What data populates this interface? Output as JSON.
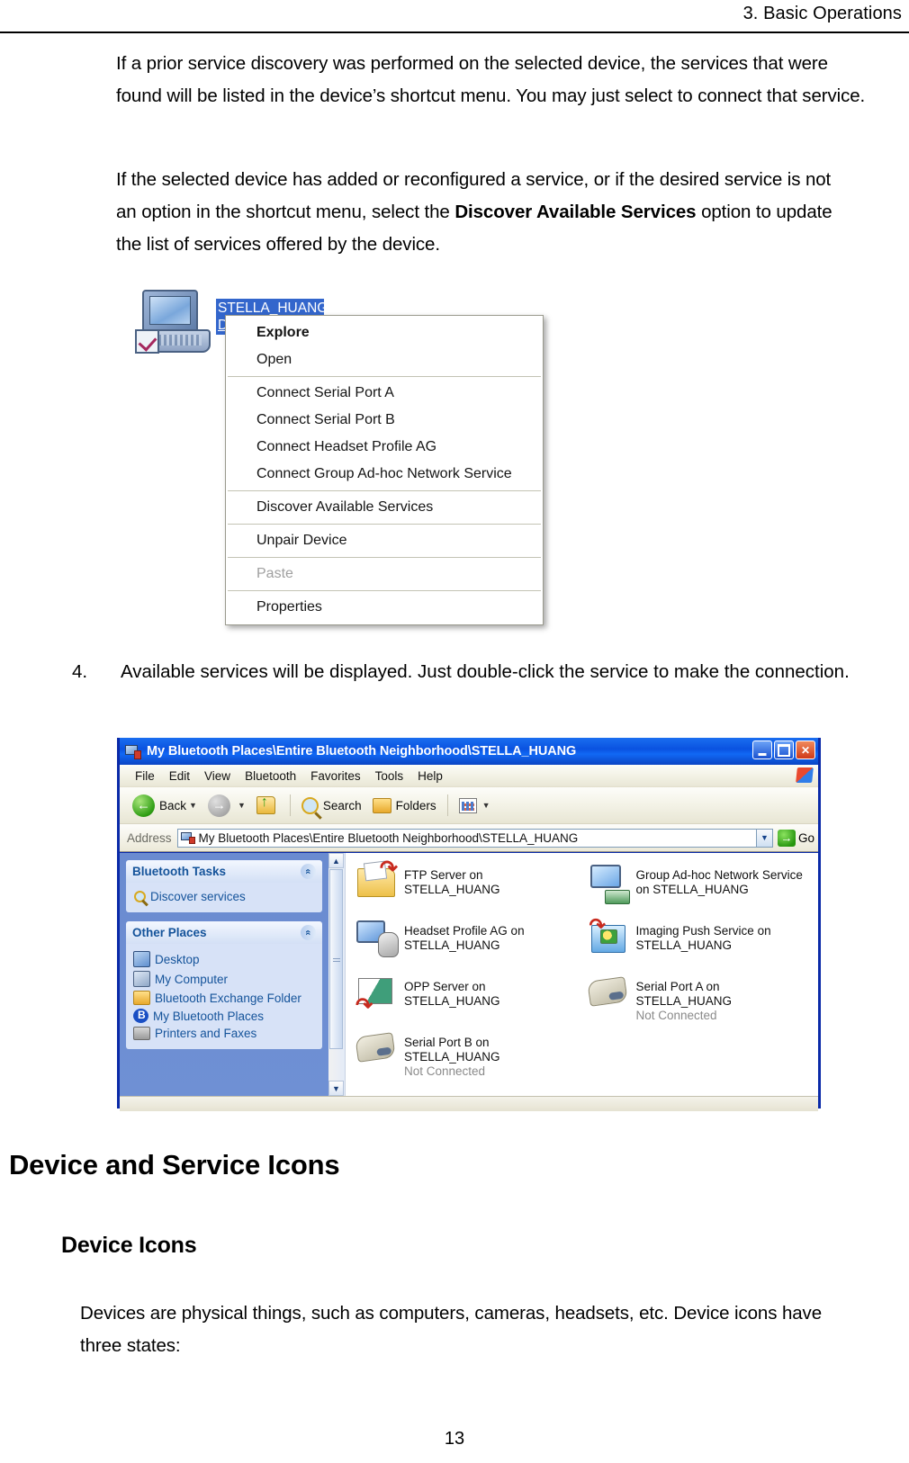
{
  "header": {
    "chapter": "3. Basic Operations"
  },
  "paragraphs": {
    "p1": "If a prior service discovery was performed on the selected device, the services that were found will be listed in the device’s shortcut menu. You may just select to connect that service.",
    "p2_a": "If the selected device has added or reconfigured a service, or if the desired service is not an option in the shortcut menu, select the ",
    "p2_bold": "Discover Available Services",
    "p2_b": " option to update the list of services offered by the device."
  },
  "step": {
    "number": "4.",
    "text": "Available services will be displayed. Just double-click the service to make the connection."
  },
  "context_menu_figure": {
    "device_label_line1": "STELLA_HUANG",
    "device_label_line2": "De",
    "items": [
      {
        "label": "Explore",
        "style": "bold"
      },
      {
        "label": "Open",
        "style": "normal"
      },
      {
        "label": "separator",
        "style": "separator"
      },
      {
        "label": "Connect Serial Port A",
        "style": "normal"
      },
      {
        "label": "Connect Serial Port B",
        "style": "normal"
      },
      {
        "label": "Connect Headset Profile AG",
        "style": "normal"
      },
      {
        "label": "Connect Group Ad-hoc Network Service",
        "style": "normal"
      },
      {
        "label": "separator",
        "style": "separator"
      },
      {
        "label": "Discover Available Services",
        "style": "normal"
      },
      {
        "label": "separator",
        "style": "separator"
      },
      {
        "label": "Unpair Device",
        "style": "normal"
      },
      {
        "label": "separator",
        "style": "separator"
      },
      {
        "label": "Paste",
        "style": "disabled"
      },
      {
        "label": "separator",
        "style": "separator"
      },
      {
        "label": "Properties",
        "style": "normal"
      }
    ]
  },
  "explorer_window": {
    "title": "My Bluetooth Places\\Entire Bluetooth Neighborhood\\STELLA_HUANG",
    "caption_buttons": {
      "minimize": "_",
      "maximize": "□",
      "close": "×"
    },
    "menus": [
      "File",
      "Edit",
      "View",
      "Bluetooth",
      "Favorites",
      "Tools",
      "Help"
    ],
    "toolbar": {
      "back": "Back",
      "forward": "",
      "up": "",
      "search": "Search",
      "folders": "Folders",
      "views": ""
    },
    "address": {
      "label": "Address",
      "value": "My Bluetooth Places\\Entire Bluetooth Neighborhood\\STELLA_HUANG",
      "go": "Go"
    },
    "sidebar": {
      "panels": [
        {
          "title": "Bluetooth Tasks",
          "links": [
            {
              "label": "Discover services",
              "icon": "magnify-icon"
            }
          ]
        },
        {
          "title": "Other Places",
          "links": [
            {
              "label": "Desktop",
              "icon": "desktop-icon"
            },
            {
              "label": "My Computer",
              "icon": "my-computer-icon"
            },
            {
              "label": "Bluetooth Exchange Folder",
              "icon": "folder-icon"
            },
            {
              "label": "My Bluetooth Places",
              "icon": "bluetooth-icon"
            },
            {
              "label": "Printers and Faxes",
              "icon": "printer-icon"
            }
          ]
        }
      ]
    },
    "files": [
      {
        "name": "FTP Server on STELLA_HUANG",
        "sub": "",
        "icon": "ftp-server-icon"
      },
      {
        "name": "Group Ad-hoc Network Service on STELLA_HUANG",
        "sub": "",
        "icon": "group-adhoc-network-icon"
      },
      {
        "name": "Headset Profile AG on STELLA_HUANG",
        "sub": "",
        "icon": "headset-profile-icon"
      },
      {
        "name": "Imaging Push Service on STELLA_HUANG",
        "sub": "",
        "icon": "imaging-push-icon"
      },
      {
        "name": "OPP Server on STELLA_HUANG",
        "sub": "",
        "icon": "opp-server-icon"
      },
      {
        "name": "Serial Port A on STELLA_HUANG",
        "sub": "Not Connected",
        "icon": "serial-port-icon"
      },
      {
        "name": "Serial Port B on STELLA_HUANG",
        "sub": "Not Connected",
        "icon": "serial-port-icon"
      }
    ]
  },
  "sections": {
    "h1": "Device and Service Icons",
    "h2": "Device Icons",
    "body": "Devices are physical things, such as computers, cameras, headsets, etc. Device icons have three states:"
  },
  "footer": {
    "page_number": "13"
  }
}
